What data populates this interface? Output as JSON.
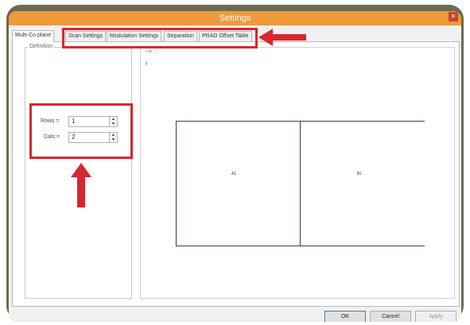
{
  "window": {
    "title": "Settings",
    "close_label": "✕"
  },
  "tabs": [
    {
      "label": "Multi-Co plane",
      "active": true
    },
    {
      "label": "Scan Settings"
    },
    {
      "label": "Modulation Settings"
    },
    {
      "label": "Separation"
    },
    {
      "label": "PRAD Offset Table"
    }
  ],
  "definition": {
    "group_label": "Definition",
    "rows_label": "Rows =",
    "rows_value": "1",
    "cols_label": "Cols =",
    "cols_value": "2"
  },
  "preview": {
    "ruler_top": "—x →",
    "ruler_side": "y",
    "cells": [
      "A1",
      "B1"
    ]
  },
  "buttons": {
    "ok": "OK",
    "cancel": "Cancel",
    "apply": "Apply"
  },
  "annotation_color": "#d8272f",
  "title_bar_color": "#ee9a3b"
}
